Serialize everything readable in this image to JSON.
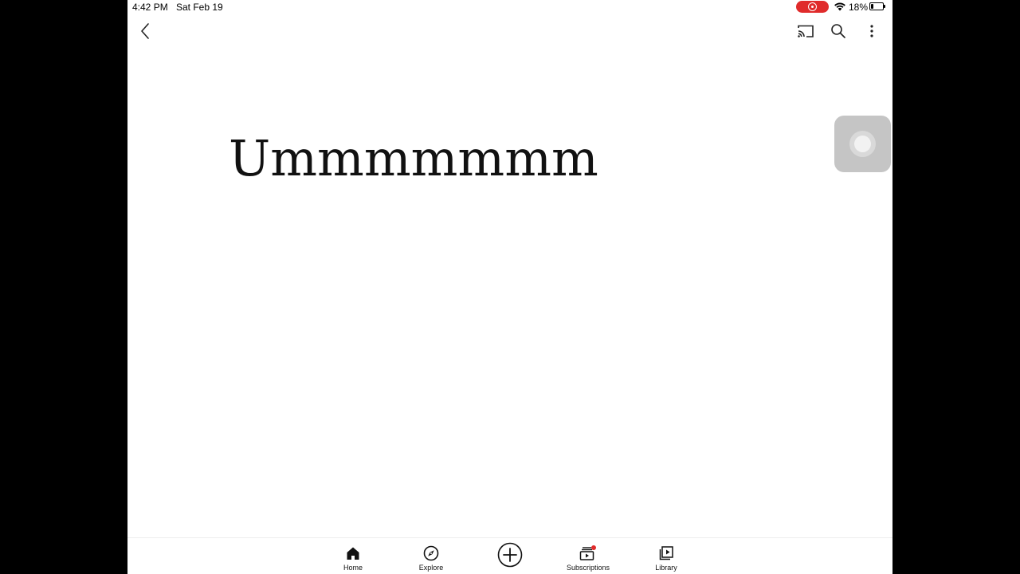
{
  "status_bar": {
    "time": "4:42 PM",
    "date": "Sat Feb 19",
    "battery_percent": "18%",
    "battery_level": 0.18,
    "recording_color": "#e02b2b"
  },
  "top_bar": {
    "back_icon": "chevron-left-icon",
    "cast_icon": "cast-icon",
    "search_icon": "search-icon",
    "more_icon": "more-vertical-icon"
  },
  "content": {
    "title": "Ummmmmmm"
  },
  "bottom_nav": {
    "items": [
      {
        "label": "Home",
        "icon": "home-icon",
        "active": true
      },
      {
        "label": "Explore",
        "icon": "compass-icon"
      },
      {
        "label": "",
        "icon": "create-plus-icon"
      },
      {
        "label": "Subscriptions",
        "icon": "subscriptions-icon",
        "badge_color": "#e02b2b"
      },
      {
        "label": "Library",
        "icon": "library-icon"
      }
    ]
  }
}
